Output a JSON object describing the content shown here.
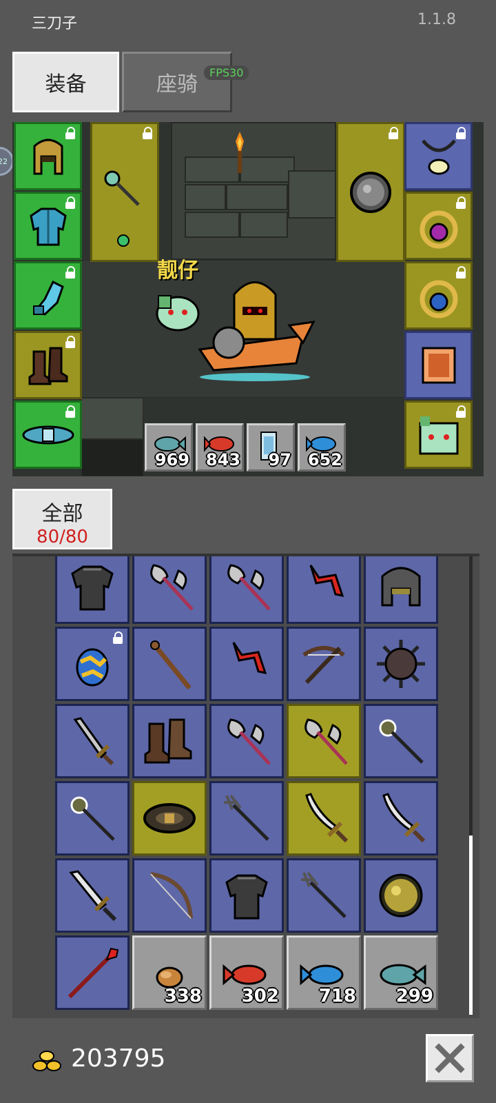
{
  "app": {
    "title": "三刀子",
    "version": "1.1.8"
  },
  "tabs": {
    "equipment": "装备",
    "mount": "座骑"
  },
  "fps": "FPS30",
  "side_bubble": "22",
  "character": {
    "name": "靓仔"
  },
  "equipment_left": [
    "helmet-icon",
    "chest-armor-icon",
    "gloves-icon",
    "boots-icon",
    "belt-icon"
  ],
  "equipment_right": [
    "amulet-icon",
    "purple-ring-icon",
    "blue-ring-icon",
    "scroll-icon",
    "pet-icon"
  ],
  "weapon": "mace-icon",
  "offhand": "round-shield-icon",
  "consumables": [
    {
      "icon": "fish-icon",
      "qty": "969"
    },
    {
      "icon": "red-fish-icon",
      "qty": "843"
    },
    {
      "icon": "scroll-potion-icon",
      "qty": "97"
    },
    {
      "icon": "blue-fish-icon",
      "qty": "652"
    }
  ],
  "filter": {
    "label": "全部",
    "count": "80/80"
  },
  "inventory": [
    {
      "icon": "dark-armor-icon",
      "style": "blue"
    },
    {
      "icon": "double-axe-icon",
      "style": "blue"
    },
    {
      "icon": "double-axe-icon",
      "style": "blue"
    },
    {
      "icon": "red-boomerang-icon",
      "style": "blue"
    },
    {
      "icon": "iron-helmet-icon",
      "style": "blue"
    },
    {
      "icon": "egg-icon",
      "style": "blue",
      "locked": true
    },
    {
      "icon": "wooden-staff-icon",
      "style": "blue"
    },
    {
      "icon": "red-boomerang-icon",
      "style": "blue"
    },
    {
      "icon": "crossbow-icon",
      "style": "blue"
    },
    {
      "icon": "spiked-ball-icon",
      "style": "blue"
    },
    {
      "icon": "sword-icon",
      "style": "blue"
    },
    {
      "icon": "leather-boots-icon",
      "style": "blue"
    },
    {
      "icon": "double-axe-icon",
      "style": "blue"
    },
    {
      "icon": "double-axe-icon",
      "style": "yellow"
    },
    {
      "icon": "morning-star-icon",
      "style": "blue"
    },
    {
      "icon": "morning-star-icon",
      "style": "blue"
    },
    {
      "icon": "leather-belt-icon",
      "style": "yellow"
    },
    {
      "icon": "trident-icon",
      "style": "blue"
    },
    {
      "icon": "scimitar-icon",
      "style": "yellow"
    },
    {
      "icon": "scimitar-icon",
      "style": "blue"
    },
    {
      "icon": "broadsword-icon",
      "style": "blue"
    },
    {
      "icon": "bow-icon",
      "style": "blue"
    },
    {
      "icon": "dark-armor-icon",
      "style": "blue"
    },
    {
      "icon": "trident-icon",
      "style": "blue"
    },
    {
      "icon": "gold-shield-icon",
      "style": "blue"
    },
    {
      "icon": "red-spear-icon",
      "style": "blue"
    },
    {
      "icon": "bread-icon",
      "style": "gray",
      "qty": "338"
    },
    {
      "icon": "red-fish-icon",
      "style": "gray",
      "qty": "302"
    },
    {
      "icon": "blue-fish-icon",
      "style": "gray",
      "qty": "718"
    },
    {
      "icon": "fish-icon",
      "style": "gray",
      "qty": "299"
    }
  ],
  "gold": "203795",
  "colors": {
    "green_slot": "#35b23b",
    "olive_slot": "#9b9622",
    "blue_slot": "#5b67ae",
    "count_red": "#d12020",
    "name_yellow": "#f3d94a"
  }
}
